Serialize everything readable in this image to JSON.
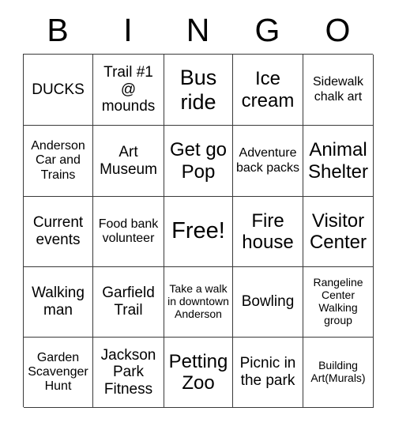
{
  "card": {
    "headers": [
      "B",
      "I",
      "N",
      "G",
      "O"
    ],
    "rows": [
      [
        {
          "text": "DUCKS",
          "size": "md"
        },
        {
          "text": "Trail #1 @ mounds",
          "size": "md"
        },
        {
          "text": "Bus ride",
          "size": "xl"
        },
        {
          "text": "Ice cream",
          "size": "lg"
        },
        {
          "text": "Sidewalk chalk art",
          "size": "sm"
        }
      ],
      [
        {
          "text": "Anderson Car and Trains",
          "size": "sm"
        },
        {
          "text": "Art Museum",
          "size": "md"
        },
        {
          "text": "Get go Pop",
          "size": "lg"
        },
        {
          "text": "Adventure back packs",
          "size": "sm"
        },
        {
          "text": "Animal Shelter",
          "size": "lg"
        }
      ],
      [
        {
          "text": "Current events",
          "size": "md"
        },
        {
          "text": "Food bank volunteer",
          "size": "sm"
        },
        {
          "text": "Free!",
          "size": "free"
        },
        {
          "text": "Fire house",
          "size": "lg"
        },
        {
          "text": "Visitor Center",
          "size": "lg"
        }
      ],
      [
        {
          "text": "Walking man",
          "size": "md"
        },
        {
          "text": "Garfield Trail",
          "size": "md"
        },
        {
          "text": "Take a walk in downtown Anderson",
          "size": "xs"
        },
        {
          "text": "Bowling",
          "size": "md"
        },
        {
          "text": "Rangeline Center Walking group",
          "size": "xs"
        }
      ],
      [
        {
          "text": "Garden Scavenger Hunt",
          "size": "sm"
        },
        {
          "text": "Jackson Park Fitness",
          "size": "md"
        },
        {
          "text": "Petting Zoo",
          "size": "lg"
        },
        {
          "text": "Picnic in the park",
          "size": "md"
        },
        {
          "text": "Building Art(Murals)",
          "size": "xs"
        }
      ]
    ]
  },
  "colors": {
    "border": "#3a3a3a",
    "background": "#ffffff",
    "text": "#000000"
  }
}
